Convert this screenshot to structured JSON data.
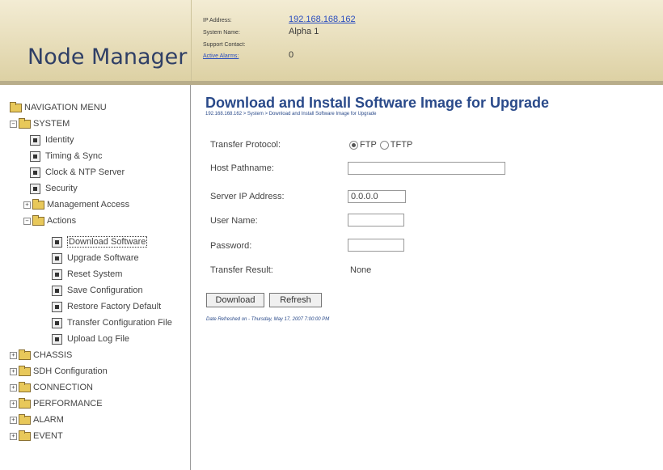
{
  "header": {
    "logo": "Node Manager",
    "ip_label": "IP Address:",
    "ip_value": "192.168.168.162",
    "system_name_label": "System Name:",
    "system_name_value": "Alpha 1",
    "support_contact_label": "Support Contact:",
    "support_contact_value": "",
    "active_alarms_label": "Active Alarms:",
    "active_alarms_value": "0"
  },
  "sidebar": {
    "root": "NAVIGATION MENU",
    "system": "SYSTEM",
    "system_items": [
      "Identity",
      "Timing & Sync",
      "Clock & NTP Server",
      "Security"
    ],
    "management_access": "Management Access",
    "actions": "Actions",
    "action_items": [
      "Download Software",
      "Upgrade Software",
      "Reset System",
      "Save Configuration",
      "Restore Factory Default",
      "Transfer Configuration File",
      "Upload Log File"
    ],
    "sections": [
      "CHASSIS",
      "SDH Configuration",
      "CONNECTION",
      "PERFORMANCE",
      "ALARM",
      "EVENT"
    ],
    "expand_symbols": {
      "collapsed": "+",
      "expanded": "−"
    }
  },
  "main": {
    "title": "Download and Install Software Image for Upgrade",
    "breadcrumb": "192.168.168.162 > System > Download and Install Software Image for Upgrade",
    "transfer_protocol_label": "Transfer Protocol:",
    "ftp_label": "FTP",
    "tftp_label": "TFTP",
    "host_pathname_label": "Host Pathname:",
    "host_pathname_value": "",
    "server_ip_label": "Server IP Address:",
    "server_ip_value": "0.0.0.0",
    "user_name_label": "User Name:",
    "user_name_value": "",
    "password_label": "Password:",
    "password_value": "",
    "transfer_result_label": "Transfer Result:",
    "transfer_result_value": "None",
    "download_button": "Download",
    "refresh_button": "Refresh",
    "refresh_note": "Date Refreshed on - Thursday, May 17, 2007 7:00:00 PM"
  }
}
